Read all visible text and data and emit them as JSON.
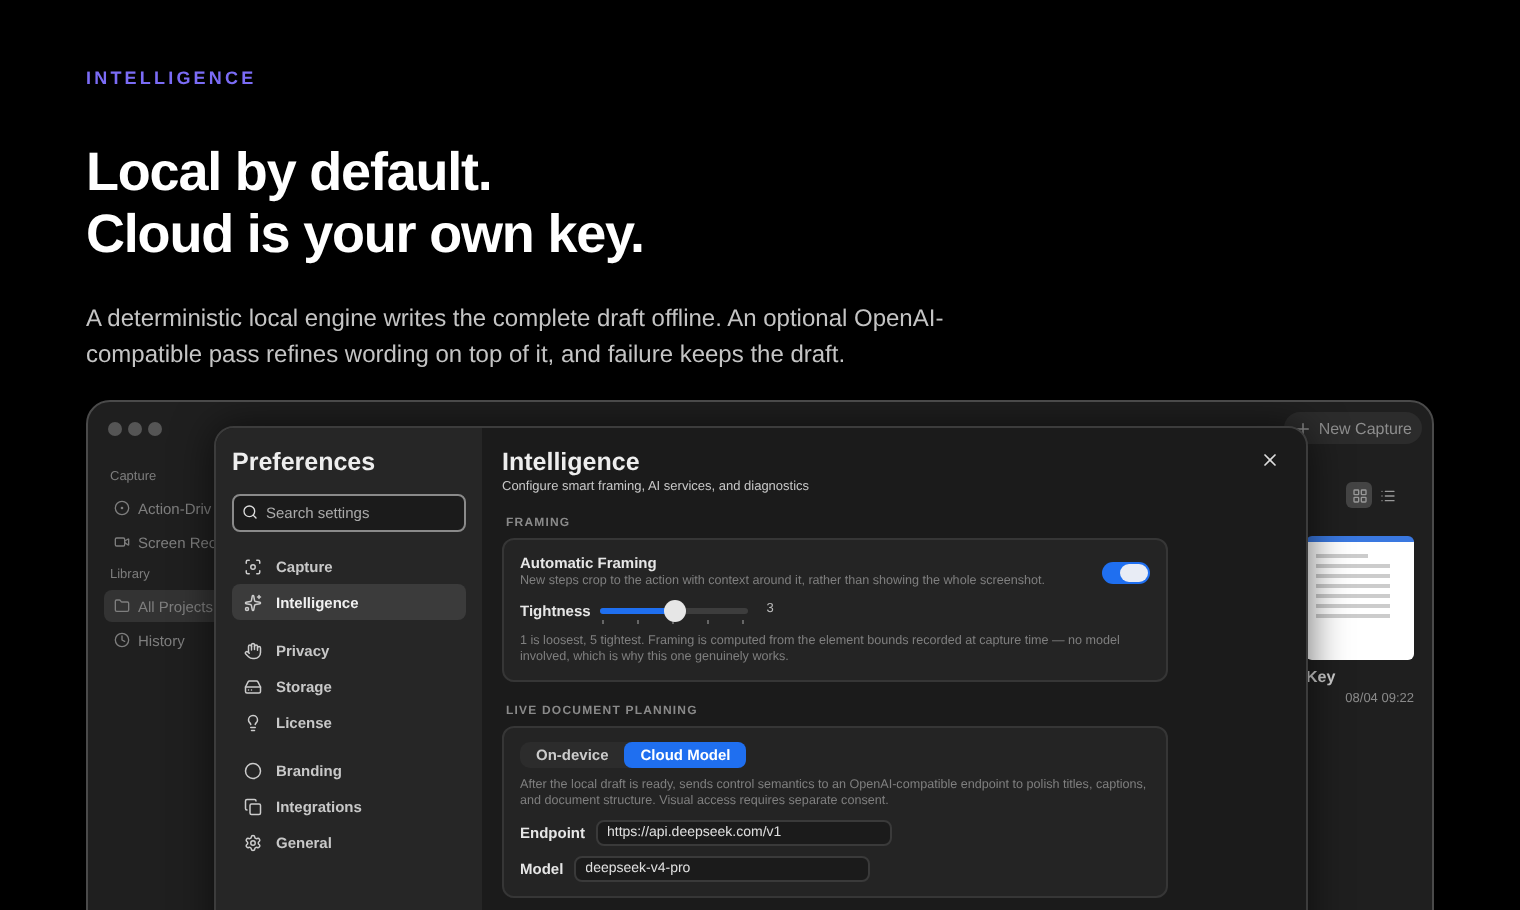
{
  "hero": {
    "eyebrow": "INTELLIGENCE",
    "headline": [
      "Local by default.",
      "Cloud is your own key."
    ],
    "body": "A deterministic local engine writes the complete draft offline. An optional OpenAI-compatible pass refines wording on top of it, and failure keeps the draft."
  },
  "app": {
    "new_capture": "New Capture",
    "sidebar": [
      {
        "heading": "Capture",
        "items": [
          {
            "kind": "action",
            "label": "Action-Driv",
            "selected": false
          },
          {
            "kind": "video",
            "label": "Screen Rec",
            "selected": false
          }
        ]
      },
      {
        "heading": "Library",
        "items": [
          {
            "kind": "folder",
            "label": "All Projects",
            "selected": true
          },
          {
            "kind": "history",
            "label": "History",
            "selected": false
          }
        ]
      }
    ],
    "view_modes": [
      {
        "kind": "grid",
        "selected": true
      },
      {
        "kind": "list",
        "selected": false
      }
    ],
    "capture_card": {
      "title": "Key",
      "date": "08/04 09:22"
    }
  },
  "preferences": {
    "title": "Preferences",
    "search": {
      "placeholder": "Search settings"
    },
    "nav_groups": [
      {
        "items": [
          {
            "kind": "capture",
            "label": "Capture",
            "selected": false
          },
          {
            "kind": "intelligence",
            "label": "Intelligence",
            "selected": true
          }
        ]
      },
      {
        "items": [
          {
            "kind": "privacy",
            "label": "Privacy",
            "selected": false
          },
          {
            "kind": "storage",
            "label": "Storage",
            "selected": false
          },
          {
            "kind": "license",
            "label": "License",
            "selected": false
          }
        ]
      },
      {
        "items": [
          {
            "kind": "branding",
            "label": "Branding",
            "selected": false
          },
          {
            "kind": "integrations",
            "label": "Integrations",
            "selected": false
          },
          {
            "kind": "general",
            "label": "General",
            "selected": false
          }
        ]
      }
    ],
    "page": {
      "title": "Intelligence",
      "subtitle": "Configure smart framing, AI services, and diagnostics"
    },
    "framing": {
      "heading": "FRAMING",
      "toggle": {
        "label": "Automatic Framing",
        "description": "New steps crop to the action with context around it, rather than showing the whole screenshot.",
        "on": true
      },
      "slider": {
        "label": "Tightness",
        "level": 0.5,
        "reading": "3"
      },
      "note": "1 is loosest, 5 tightest. Framing is computed from the element bounds recorded at capture time — no model involved, which is why this one genuinely works."
    },
    "planning": {
      "heading": "LIVE DOCUMENT PLANNING",
      "modes": [
        {
          "label": "On-device",
          "selected": false
        },
        {
          "label": "Cloud Model",
          "selected": true
        }
      ],
      "description": "After the local draft is ready, sends control semantics to an OpenAI-compatible endpoint to polish titles, captions, and document structure. Visual access requires separate consent.",
      "fields": [
        {
          "label": "Endpoint",
          "value": "https://api.deepseek.com/v1"
        },
        {
          "label": "Model",
          "value": "deepseek-v4-pro"
        }
      ]
    }
  }
}
